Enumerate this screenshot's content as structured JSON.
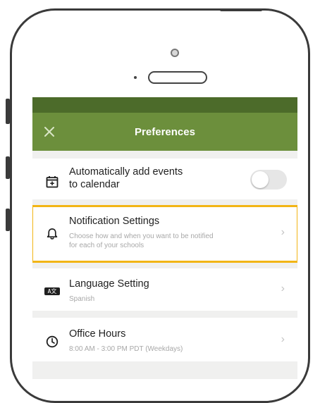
{
  "header": {
    "title": "Preferences",
    "close_icon": "close-icon"
  },
  "settings": [
    {
      "icon": "calendar-plus-icon",
      "title_line1": "Automatically add events",
      "title_line2": "to calendar",
      "control": "toggle",
      "toggle_on": false
    },
    {
      "icon": "bell-icon",
      "title": "Notification Settings",
      "subtitle_line1": "Choose how and when you want to be notified",
      "subtitle_line2": "for each of your schools",
      "highlighted": true,
      "highlight_color": "#f2b515"
    },
    {
      "icon": "language-icon",
      "icon_text": "A文",
      "title": "Language Setting",
      "subtitle": "Spanish"
    },
    {
      "icon": "clock-icon",
      "title": "Office Hours",
      "subtitle": "8:00 AM - 3:00 PM PDT (Weekdays)"
    }
  ],
  "colors": {
    "header_green": "#6c8f3c",
    "status_green": "#4c6b2a",
    "background": "#f0f0ef"
  }
}
